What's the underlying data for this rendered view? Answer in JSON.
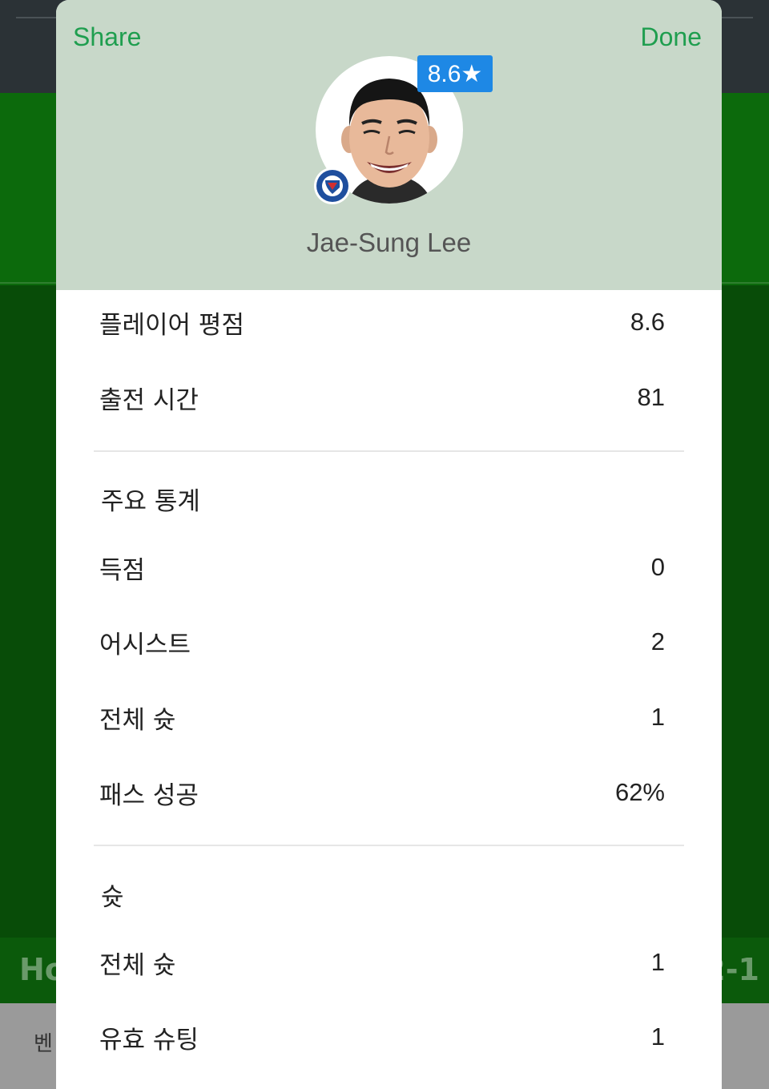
{
  "background": {
    "home_partial": "Ho",
    "score_partial": "2-1",
    "bench_partial": "벤"
  },
  "sheet": {
    "share_label": "Share",
    "done_label": "Done",
    "rating_badge": "8.6★",
    "player_name": "Jae-Sung Lee",
    "summary": [
      {
        "label": "플레이어 평점",
        "value": "8.6"
      },
      {
        "label": "출전 시간",
        "value": "81"
      }
    ],
    "key_stats": {
      "title": "주요 통계",
      "rows": [
        {
          "label": "득점",
          "value": "0"
        },
        {
          "label": "어시스트",
          "value": "2"
        },
        {
          "label": "전체 슛",
          "value": "1"
        },
        {
          "label": "패스 성공",
          "value": "62%"
        }
      ]
    },
    "shots": {
      "title": "슛",
      "rows": [
        {
          "label": "전체 슛",
          "value": "1"
        },
        {
          "label": "유효 슈팅",
          "value": "1"
        }
      ]
    }
  },
  "colors": {
    "accent_green": "#1f9e4f",
    "header_bg": "#c8d8c9",
    "badge_blue": "#1e88e5"
  },
  "icons": [
    "player-photo",
    "club-crest-icon",
    "star-icon"
  ]
}
